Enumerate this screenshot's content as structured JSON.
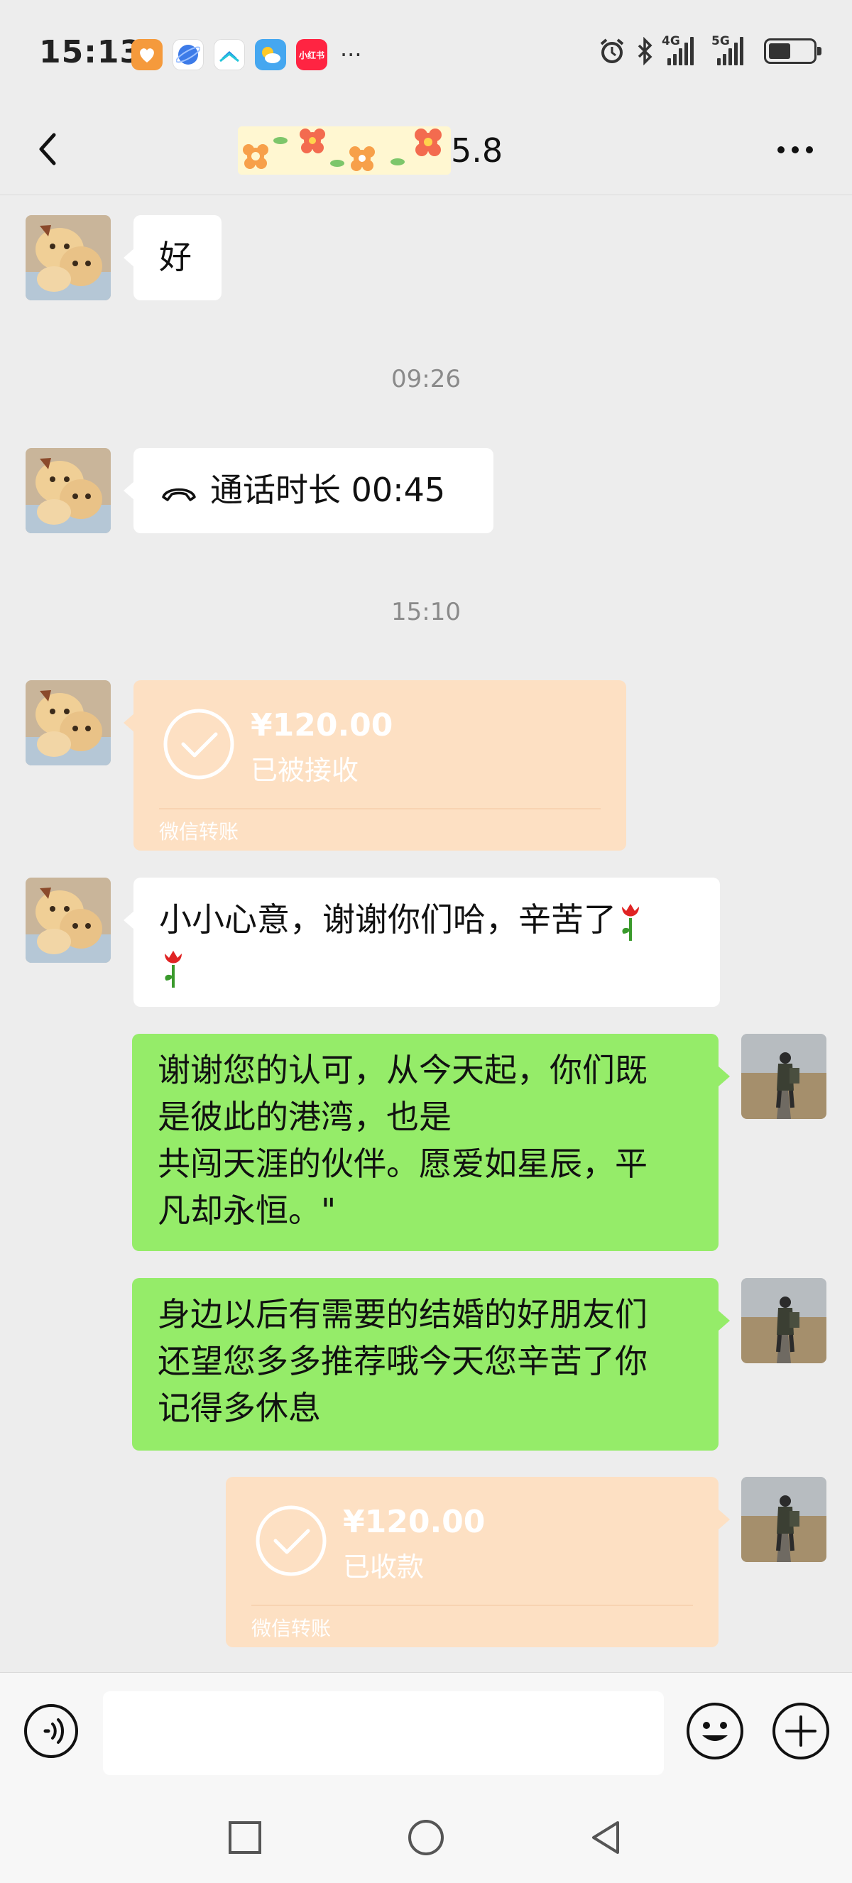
{
  "status_bar": {
    "time": "15:13",
    "app_icons": [
      {
        "name": "heart-app-icon",
        "color": "#f59a3c",
        "label": ""
      },
      {
        "name": "browser-app-icon",
        "color": "#3d7be8",
        "label": ""
      },
      {
        "name": "cloud-app-icon",
        "color": "#ffffff",
        "label": ""
      },
      {
        "name": "weather-app-icon",
        "color": "#45a7f0",
        "label": ""
      },
      {
        "name": "xiaohongshu-app-icon",
        "color": "#ff2442",
        "label": "小红书"
      }
    ],
    "overflow": "···",
    "network1": "4G",
    "network2": "5G",
    "battery_level": 0.5
  },
  "header": {
    "title_suffix": "5.8",
    "back_icon": "chevron-left-icon",
    "more_icon": "more-horizontal-icon"
  },
  "messages": {
    "m1": {
      "text": "好"
    },
    "t1": "09:26",
    "m2": {
      "label": "通话时长 00:45"
    },
    "t2": "15:10",
    "m3": {
      "amount": "¥120.00",
      "status": "已被接收",
      "brand": "微信转账"
    },
    "m4": {
      "text": "小小心意，谢谢你们哈，辛苦了"
    },
    "m5": {
      "lines": [
        "谢谢您的认可，从今天起，你们既",
        "是彼此的港湾，也是",
        "共闯天涯的伙伴。愿爱如星辰，平",
        "凡却永恒。\""
      ]
    },
    "m6": {
      "lines": [
        "身边以后有需要的结婚的好朋友们",
        "还望您多多推荐哦今天您辛苦了你",
        "记得多休息"
      ]
    },
    "m7": {
      "amount": "¥120.00",
      "status": "已收款",
      "brand": "微信转账"
    }
  },
  "input_bar": {
    "placeholder": ""
  },
  "colors": {
    "background": "#ededed",
    "green_bubble": "#95ec69",
    "white_bubble": "#ffffff",
    "transfer_bubble": "#fde0c3"
  }
}
